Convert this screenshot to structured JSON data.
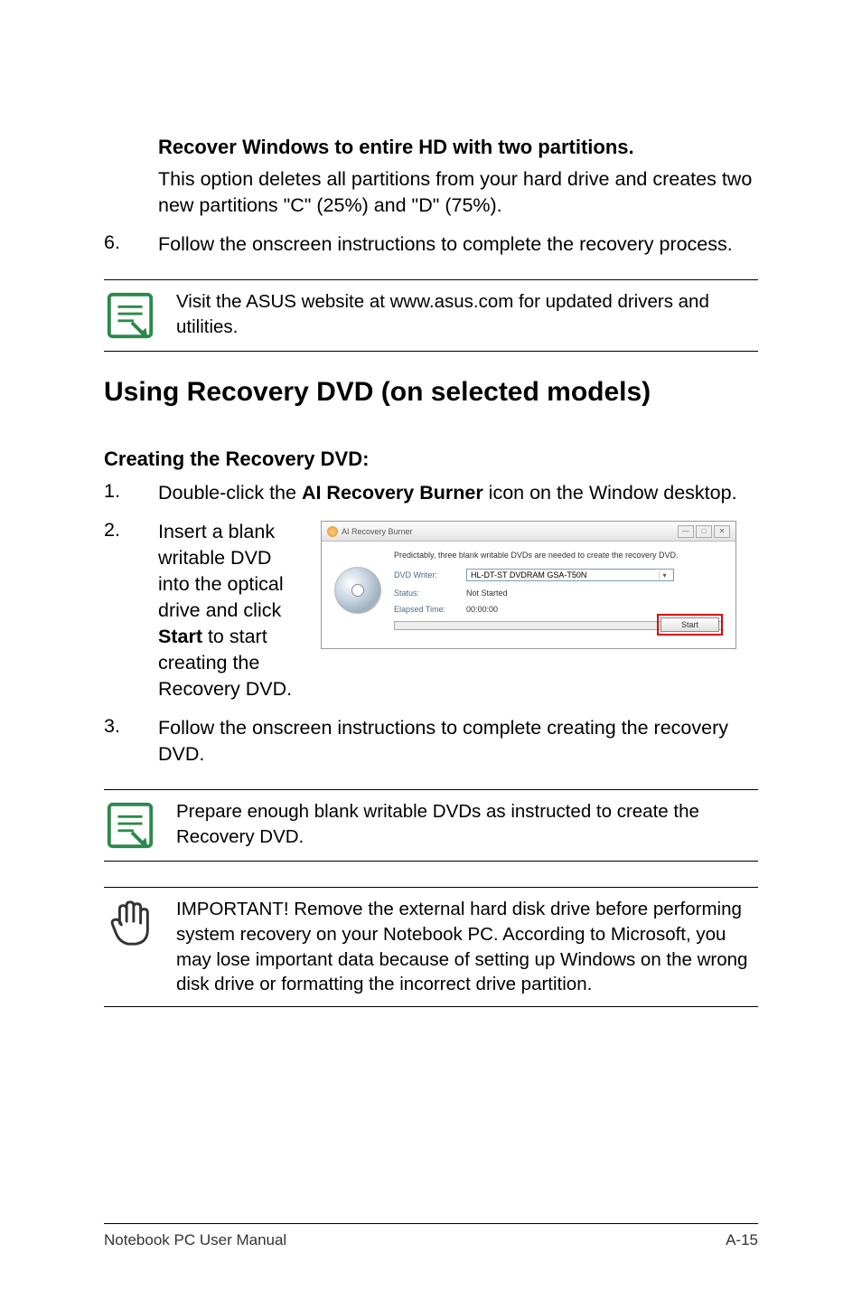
{
  "section1": {
    "heading": "Recover Windows to entire HD with two partitions.",
    "desc": "This option deletes all partitions from your hard drive and creates two new partitions \"C\" (25%) and \"D\" (75%)."
  },
  "item6": {
    "num": "6.",
    "text": "Follow the onscreen instructions to complete the recovery process."
  },
  "note1": "Visit the ASUS website at www.asus.com for updated drivers and utilities.",
  "majorHeading": "Using Recovery DVD (on selected models)",
  "subHeading": "Creating the Recovery DVD:",
  "item1": {
    "num": "1.",
    "prefix": "Double-click the ",
    "bold": "AI Recovery Burner",
    "suffix": " icon on the Window desktop."
  },
  "item2": {
    "num": "2.",
    "prefix": "Insert a blank writable DVD into the optical drive and click ",
    "bold": "Start",
    "suffix": " to start creating the Recovery DVD."
  },
  "screenshot": {
    "title": "AI Recovery Burner",
    "message": "Predictably, three blank writable DVDs are needed to create the recovery DVD.",
    "writerLabel": "DVD Writer:",
    "writerValue": "HL-DT-ST DVDRAM GSA-T50N",
    "statusLabel": "Status:",
    "statusValue": "Not Started",
    "elapsedLabel": "Elapsed Time:",
    "elapsedValue": "00:00:00",
    "startBtn": "Start"
  },
  "item3": {
    "num": "3.",
    "text": "Follow the onscreen instructions to complete creating the recovery DVD."
  },
  "note2": "Prepare enough blank writable DVDs as instructed to create the Recovery DVD.",
  "note3": "IMPORTANT! Remove the external hard disk drive before performing system recovery on your Notebook PC. According to Microsoft, you may lose important data because of setting up Windows on the wrong disk drive or formatting the incorrect drive partition.",
  "footer": {
    "left": "Notebook PC User Manual",
    "right": "A-15"
  }
}
